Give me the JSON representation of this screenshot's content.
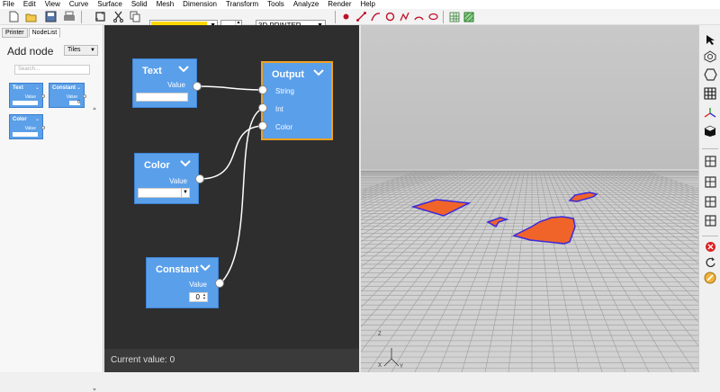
{
  "menu": [
    "File",
    "Edit",
    "View",
    "Curve",
    "Surface",
    "Solid",
    "Mesh",
    "Dimension",
    "Transform",
    "Tools",
    "Analyze",
    "Render",
    "Help"
  ],
  "toolbar": {
    "color_value": "#ffd700",
    "mode": "3D PRINTER",
    "icons": [
      "new-icon",
      "open-icon",
      "save-icon",
      "print-icon",
      "frame-icon",
      "cut-icon",
      "copy-icon",
      "paste-icon",
      "point-icon",
      "line-icon",
      "curve-icon",
      "circle-icon",
      "polyline-icon",
      "arc-icon",
      "ellipse-icon",
      "grid-icon",
      "mesh-icon"
    ]
  },
  "left_panel": {
    "tabs": [
      "Printer",
      "NodeList"
    ],
    "active_tab": "NodeList",
    "heading": "Add node",
    "view_mode": "Tiles",
    "search_placeholder": "Search...",
    "tiles": [
      {
        "title": "Text",
        "value_label": "Value"
      },
      {
        "title": "Constant",
        "value_label": "Value",
        "value": "0"
      },
      {
        "title": "Color",
        "value_label": "Value"
      }
    ]
  },
  "node_editor": {
    "nodes": {
      "text": {
        "title": "Text",
        "output_label": "Value",
        "value": ""
      },
      "color": {
        "title": "Color",
        "output_label": "Value"
      },
      "constant": {
        "title": "Constant",
        "output_label": "Value",
        "value": "0"
      },
      "output": {
        "title": "Output",
        "inputs": [
          "String",
          "Int",
          "Color"
        ]
      }
    },
    "status": "Current value:  0"
  },
  "colors": {
    "node_fill": "#5a9fea",
    "selection": "#f0a020",
    "canvas": "#2e2e2e",
    "shape_fill": "#f0642a",
    "shape_outline": "#3a2adc"
  },
  "view3d": {
    "axis_labels": [
      "Z",
      "X",
      "Y"
    ]
  },
  "right_toolbar": {
    "icons": [
      "select-arrow-icon",
      "sphere-view-icon",
      "hexagon-icon",
      "grid-view-icon",
      "axes-icon",
      "cube-view-icon",
      "layout-icon",
      "layout-icon",
      "layout-icon",
      "layout-icon",
      "close-red-icon",
      "rotate-icon",
      "link-icon"
    ]
  }
}
